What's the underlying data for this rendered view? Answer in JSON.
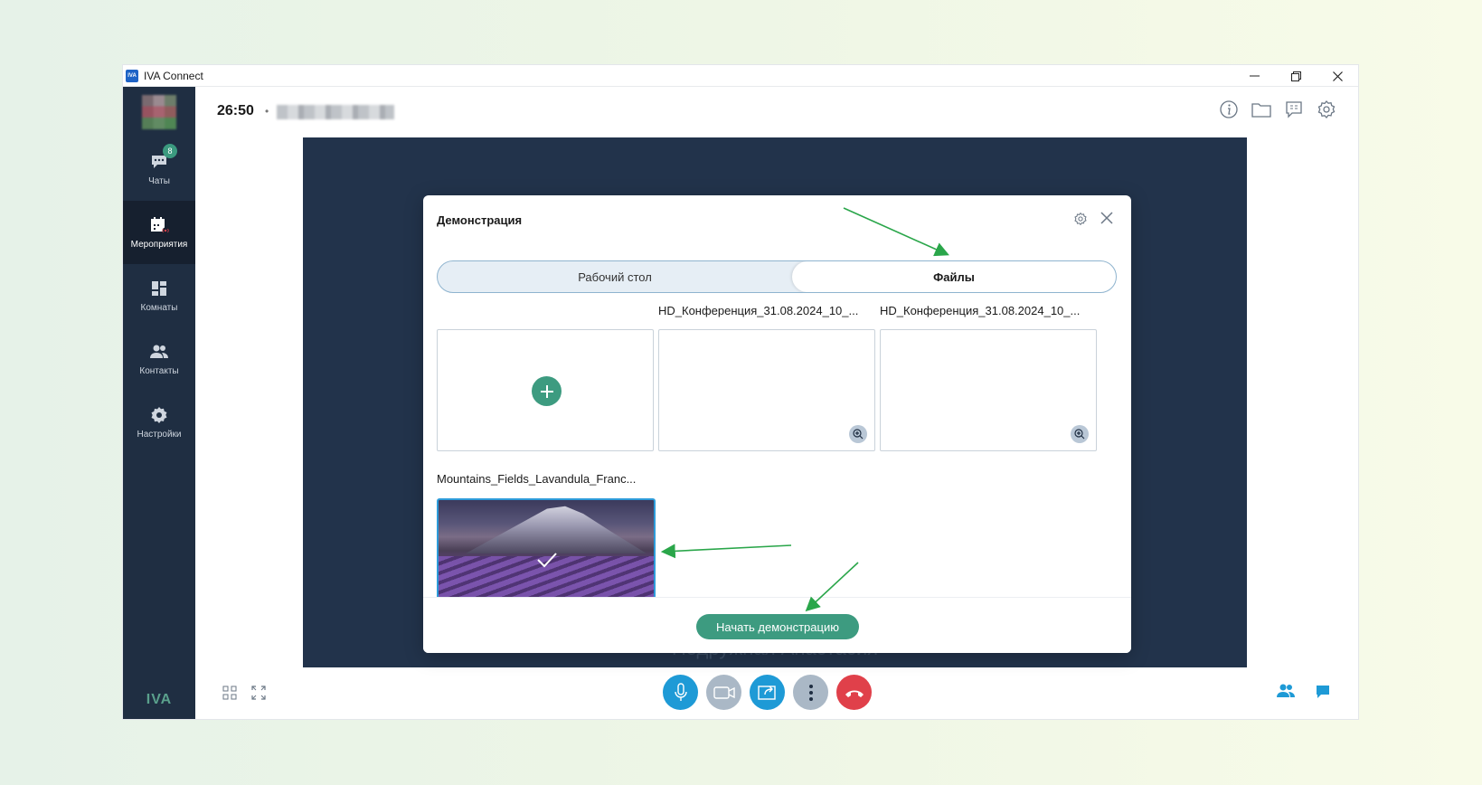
{
  "window": {
    "app_icon": "IVA",
    "title": "IVA Connect",
    "controls": [
      "minimize",
      "restore",
      "close"
    ]
  },
  "sidebar": {
    "items": [
      {
        "label": "Чаты",
        "icon": "chat-icon",
        "badge": "8"
      },
      {
        "label": "Мероприятия",
        "icon": "calendar-icon",
        "active": true
      },
      {
        "label": "Комнаты",
        "icon": "rooms-icon"
      },
      {
        "label": "Контакты",
        "icon": "contacts-icon"
      },
      {
        "label": "Настройки",
        "icon": "settings-icon"
      }
    ],
    "logo": "IVA"
  },
  "topbar": {
    "timer": "26:50",
    "separator": "•"
  },
  "stage": {
    "participant_name": "Подружная Анастасия"
  },
  "modal": {
    "title": "Демонстрация",
    "tabs": {
      "desktop": "Рабочий стол",
      "files": "Файлы",
      "active": "files"
    },
    "files": [
      {
        "name": "HD_Конференция_31.08.2024_10_..."
      },
      {
        "name": "HD_Конференция_31.08.2024_10_..."
      },
      {
        "name": "Mountains_Fields_Lavandula_Franc...",
        "selected": true
      }
    ],
    "start_button": "Начать демонстрацию"
  },
  "colors": {
    "accent": "#3d9b80",
    "sidebar": "#1f2e42",
    "stage": "#22334b",
    "primary_blue": "#1e9ad6",
    "end_call": "#e0404a",
    "arrow": "#2aa64a"
  }
}
